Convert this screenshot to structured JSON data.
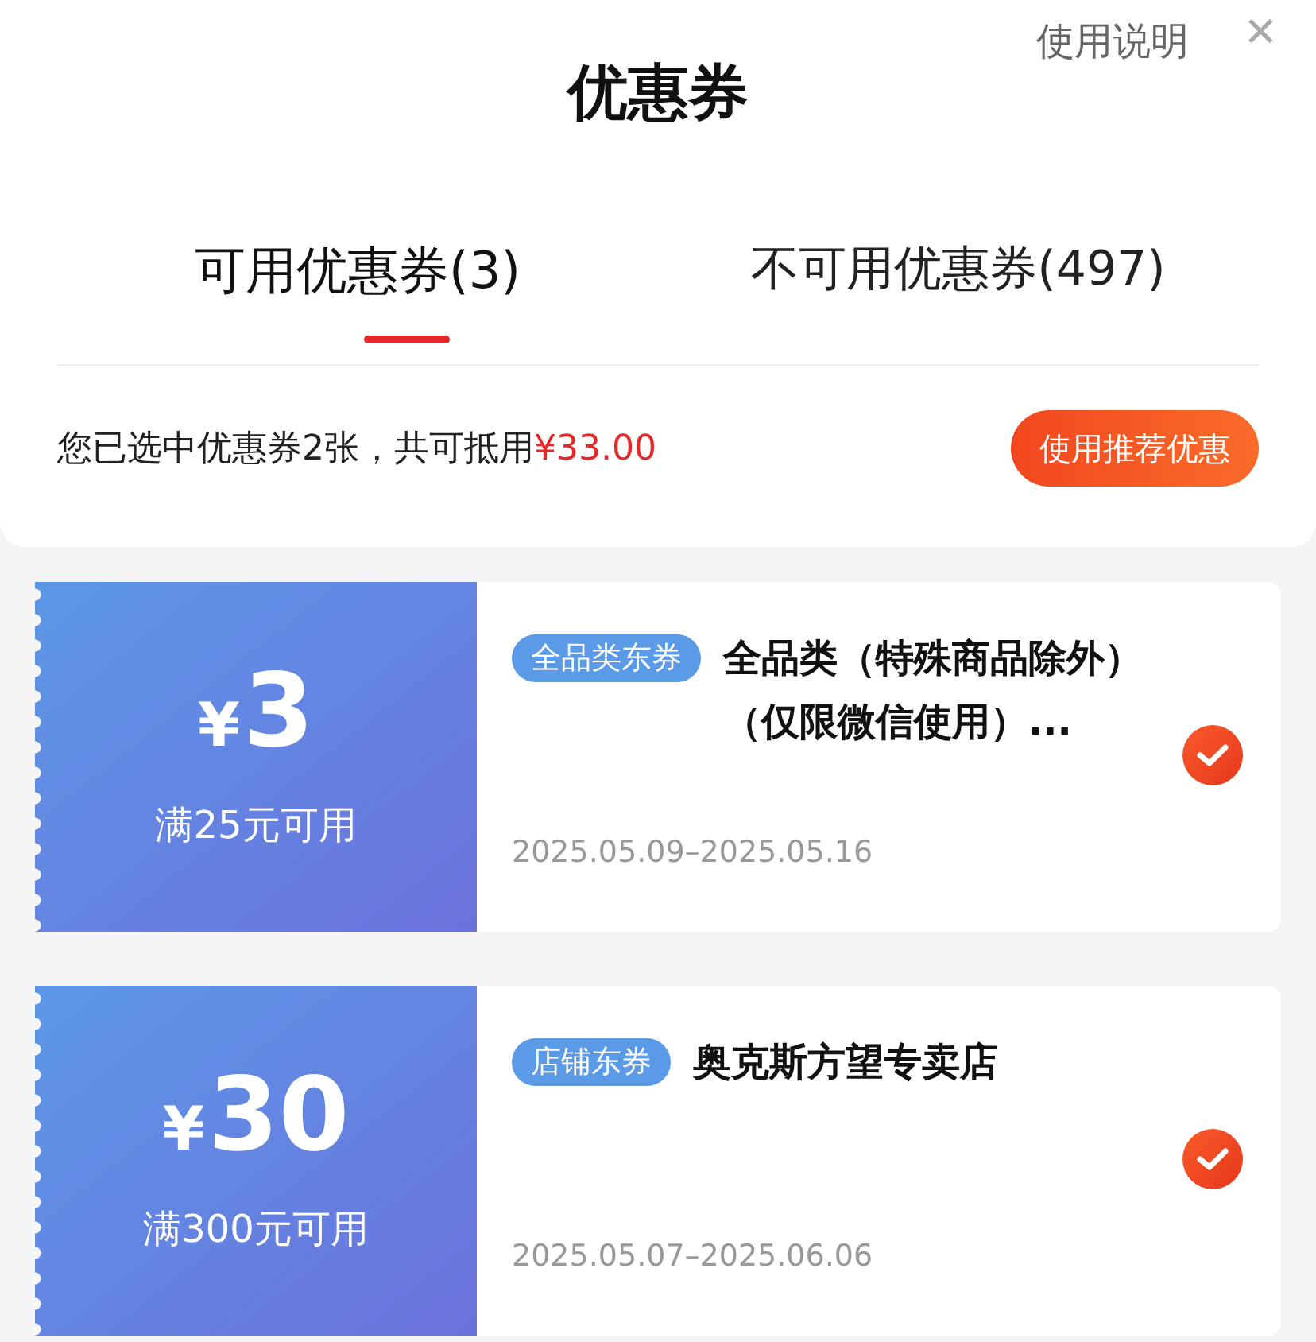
{
  "header": {
    "title": "优惠券",
    "help_link": "使用说明",
    "close": "✕"
  },
  "tabs": [
    {
      "label": "可用优惠券(3)",
      "selected": true
    },
    {
      "label": "不可用优惠券(497)",
      "selected": false
    }
  ],
  "summary": {
    "text": "您已选中优惠券2张，共可抵用",
    "amount": "¥33.00",
    "button": "使用推荐优惠"
  },
  "coupons": [
    {
      "currency": "¥",
      "value": "3",
      "condition": "满25元可用",
      "tag": "全品类东券",
      "title": "全品类（特殊商品除外）（仅限微信使用）...",
      "validity": "2025.05.09–2025.05.16",
      "selected": true
    },
    {
      "currency": "¥",
      "value": "30",
      "condition": "满300元可用",
      "tag": "店铺东券",
      "title": "奥克斯方望专卖店",
      "validity": "2025.05.07–2025.06.06",
      "selected": true
    }
  ]
}
